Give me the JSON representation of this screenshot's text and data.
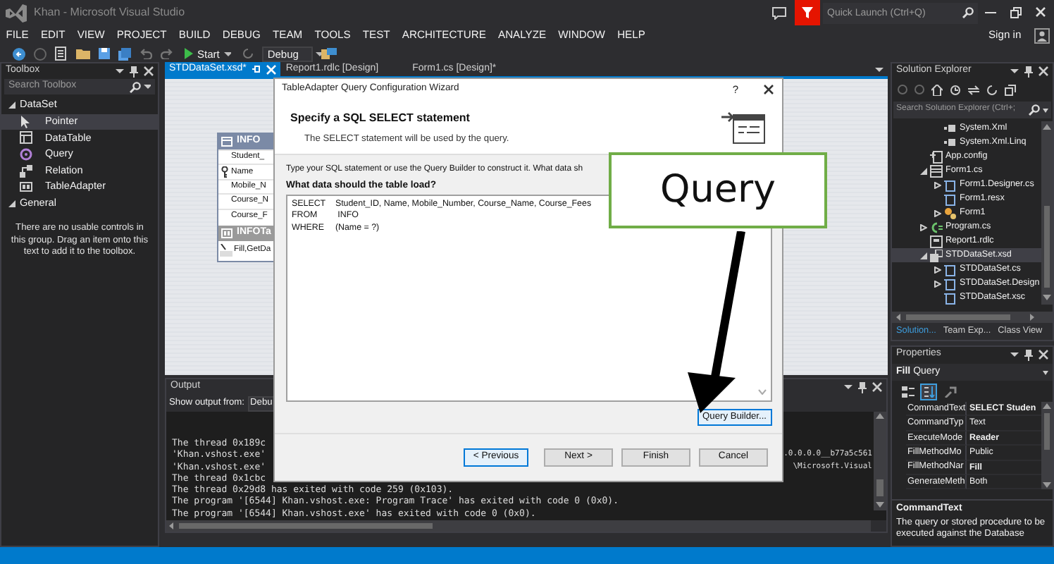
{
  "window": {
    "title": "Khan - Microsoft Visual Studio",
    "quick_launch": {
      "placeholder": "Quick Launch (Ctrl+Q)"
    }
  },
  "menu": [
    "FILE",
    "EDIT",
    "VIEW",
    "PROJECT",
    "BUILD",
    "DEBUG",
    "TEAM",
    "TOOLS",
    "TEST",
    "ARCHITECTURE",
    "ANALYZE",
    "WINDOW",
    "HELP"
  ],
  "account": {
    "label": "Sign in"
  },
  "toolbar": {
    "start": "Start",
    "configuration": "Debug"
  },
  "toolbox": {
    "title": "Toolbox",
    "search": {
      "placeholder": "Search Toolbox"
    },
    "groups": [
      {
        "label": "DataSet",
        "expanded": true,
        "items": [
          {
            "label": "Pointer",
            "kind": "pointer",
            "selected": true
          },
          {
            "label": "DataTable",
            "kind": "datatable",
            "selected": false
          },
          {
            "label": "Query",
            "kind": "query",
            "selected": false
          },
          {
            "label": "Relation",
            "kind": "relation",
            "selected": false
          },
          {
            "label": "TableAdapter",
            "kind": "tableadapter",
            "selected": false
          }
        ]
      },
      {
        "label": "General",
        "expanded": true,
        "message": "There are no usable controls in this group. Drag an item onto this text to add it to the toolbox."
      }
    ]
  },
  "document_tabs": [
    {
      "label": "STDDataSet.xsd*",
      "selected": true
    },
    {
      "label": "Report1.rdlc [Design]",
      "selected": false
    },
    {
      "label": "Form1.cs [Design]*",
      "selected": false
    }
  ],
  "designer": {
    "table": {
      "title": "INFO",
      "columns": [
        {
          "label": "Student_",
          "key": false
        },
        {
          "label": "Name",
          "key": true
        },
        {
          "label": "Mobile_N",
          "key": false
        },
        {
          "label": "Course_N",
          "key": false
        },
        {
          "label": "Course_F",
          "key": false
        }
      ],
      "adapter": {
        "title": "INFOTa",
        "query": "Fill,GetDa"
      }
    }
  },
  "output": {
    "title": "Output",
    "show_from_label": "Show output from:",
    "source": "Debu",
    "lines": [
      {
        "text": "The thread 0x189c"
      },
      {
        "text": "'Khan.vshost.exe'",
        "tail": ".0.0.0.0__b77a5c561"
      },
      {
        "text": "'Khan.vshost.exe'",
        "tail": "\\Microsoft.Visual"
      },
      {
        "text": "The thread 0x1cbc"
      },
      {
        "text": "The thread 0x29d8 has exited with code 259 (0x103)."
      },
      {
        "text": "The program '[6544] Khan.vshost.exe: Program Trace' has exited with code 0 (0x0)."
      },
      {
        "text": "The program '[6544] Khan.vshost.exe' has exited with code 0 (0x0)."
      }
    ]
  },
  "solution_explorer": {
    "title": "Solution Explorer",
    "search": {
      "placeholder": "Search Solution Explorer (Ctrl+;"
    },
    "tree": [
      {
        "children": [
          {
            "label": "System.Xml",
            "kind": "reference",
            "selected": false
          },
          {
            "label": "System.Xml.Linq",
            "kind": "reference",
            "selected": false
          }
        ]
      },
      {
        "label": "App.config",
        "kind": "config",
        "selected": false
      },
      {
        "label": "Form1.cs",
        "kind": "form",
        "expanded": true,
        "selected": false,
        "children": [
          {
            "label": "Form1.Designer.cs",
            "kind": "file",
            "expanded": false,
            "selected": false
          },
          {
            "label": "Form1.resx",
            "kind": "file",
            "selected": false
          },
          {
            "label": "Form1",
            "kind": "component",
            "expanded": false,
            "selected": false
          }
        ]
      },
      {
        "label": "Program.cs",
        "kind": "csharp",
        "expanded": false,
        "selected": false
      },
      {
        "label": "Report1.rdlc",
        "kind": "report",
        "selected": false
      },
      {
        "label": "STDDataSet.xsd",
        "kind": "dataset",
        "expanded": true,
        "selected": true,
        "children": [
          {
            "label": "STDDataSet.cs",
            "kind": "file",
            "expanded": false,
            "selected": false
          },
          {
            "label": "STDDataSet.Design",
            "kind": "file",
            "expanded": false,
            "selected": false
          },
          {
            "label": "STDDataSet.xsc",
            "kind": "file",
            "selected": false
          }
        ]
      }
    ],
    "tabs": [
      {
        "label": "Solution...",
        "selected": true
      },
      {
        "label": "Team Exp...",
        "selected": false
      },
      {
        "label": "Class View",
        "selected": false
      }
    ]
  },
  "properties": {
    "title": "Properties",
    "object": "**Fill** Query",
    "toolbar": [
      {
        "kind": "categorized",
        "selected": false
      },
      {
        "kind": "alphabetical",
        "selected": true
      },
      {
        "kind": "pages",
        "selected": false
      }
    ],
    "rows": [
      {
        "name": "CommandText",
        "value": "SELECT Studen",
        "modified": true
      },
      {
        "name": "CommandTyp",
        "value": "Text",
        "modified": false
      },
      {
        "name": "ExecuteMode",
        "value": "Reader",
        "modified": true
      },
      {
        "name": "FillMethodMo",
        "value": "Public",
        "modified": false
      },
      {
        "name": "FillMethodNar",
        "value": "Fill",
        "modified": true
      },
      {
        "name": "GenerateMeth",
        "value": "Both",
        "modified": false
      }
    ],
    "description": {
      "title": "CommandText",
      "text": "The query or stored procedure to be executed against the Database"
    }
  },
  "dialog": {
    "title": "TableAdapter Query Configuration Wizard",
    "help": "?",
    "heading": "Specify a SQL SELECT statement",
    "subheading": "The SELECT statement will be used by the query.",
    "instruction": "Type your SQL statement or use the Query Builder to construct it. What data sh",
    "prompt": "What data should the table load?",
    "sql": "SELECT\tStudent_ID, Name, Mobile_Number, Course_Name, Course_Fees\nFROM\t INFO\nWHERE\t(Name = ?)",
    "query_builder": {
      "label": "Query Builder...",
      "focused": true
    },
    "buttons": [
      {
        "label": "< Previous",
        "focused": true
      },
      {
        "label": "Next >",
        "focused": false
      },
      {
        "label": "Finish",
        "focused": false
      },
      {
        "label": "Cancel",
        "focused": false
      }
    ]
  },
  "callout": {
    "text": "Query"
  }
}
